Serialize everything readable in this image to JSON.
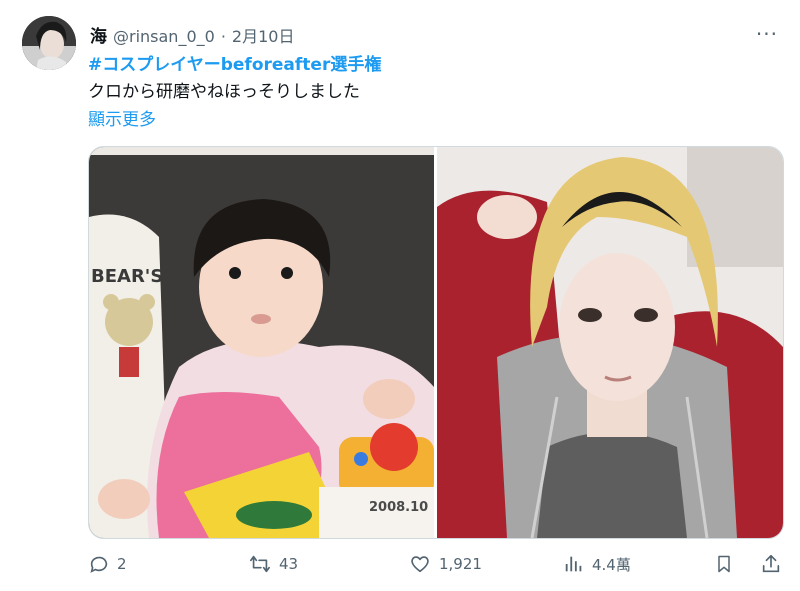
{
  "tweet": {
    "display_name": "海",
    "handle": "@rinsan_0_0",
    "separator": "·",
    "date": "2月10日",
    "more_label": "···",
    "hashtag": "#コスプレイヤーbeforeafter選手権",
    "text": "クロから研磨やねほっそりしました",
    "show_more": "顯示更多"
  },
  "media": {
    "left_photo_stamp": "2008.10",
    "left_bib_text": "BEAR'S"
  },
  "actions": {
    "reply_count": "2",
    "retweet_count": "43",
    "like_count": "1,921",
    "views_count": "4.4萬"
  },
  "colors": {
    "accent": "#1d9bf0",
    "secondary_text": "#536471",
    "border": "#cfd9de"
  }
}
